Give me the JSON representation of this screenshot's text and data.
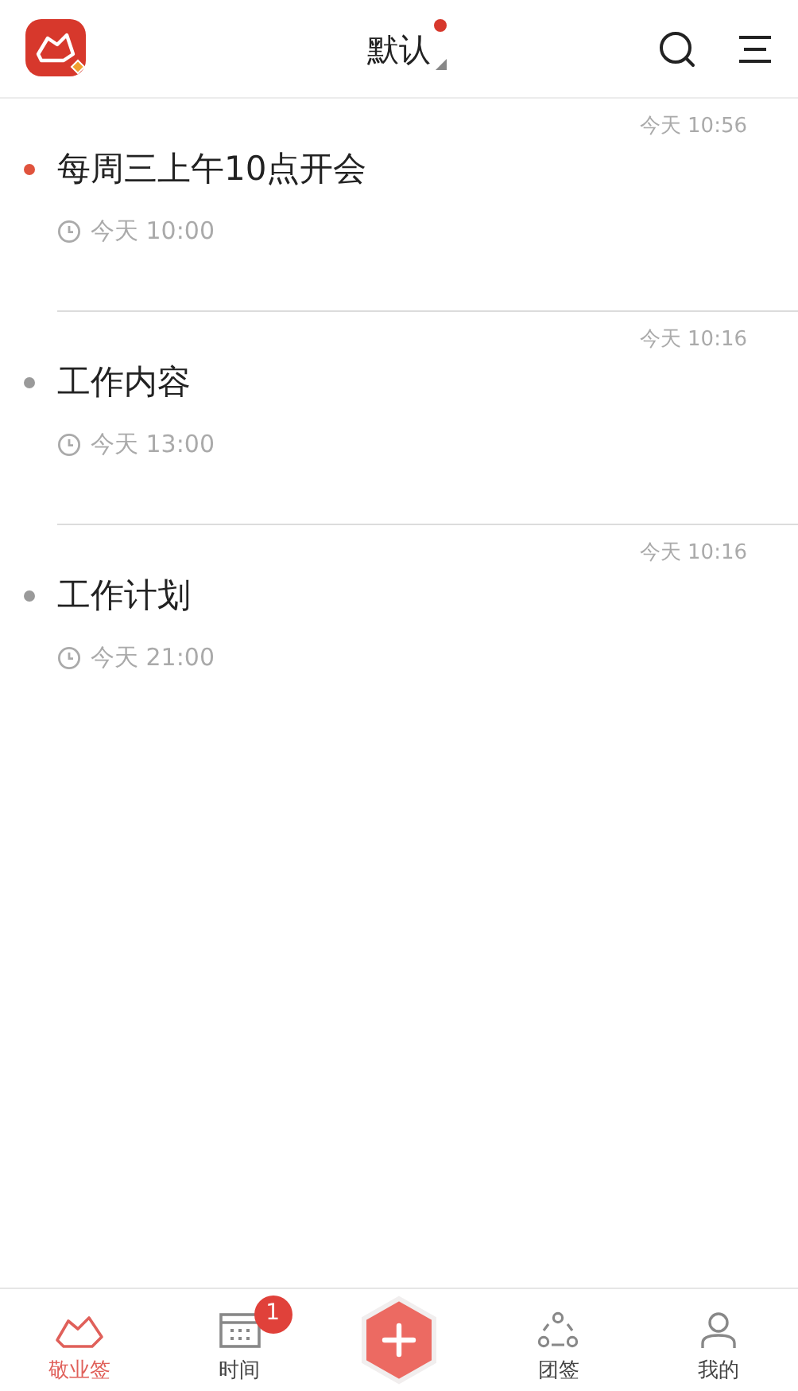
{
  "header": {
    "title": "默认",
    "unread": true
  },
  "notes": [
    {
      "created": "今天 10:56",
      "title": "每周三上午10点开会",
      "reminder": "今天 10:00",
      "color": "#e0533d"
    },
    {
      "created": "今天 10:16",
      "title": "工作内容",
      "reminder": "今天 13:00",
      "color": "#9a9a9a"
    },
    {
      "created": "今天 10:16",
      "title": "工作计划",
      "reminder": "今天 21:00",
      "color": "#9a9a9a"
    }
  ],
  "tabs": [
    {
      "kind": "notes",
      "label": "敬业签",
      "selected": true
    },
    {
      "kind": "calendar",
      "label": "时间",
      "selected": false,
      "badge": "1"
    },
    {
      "kind": "add"
    },
    {
      "kind": "team",
      "label": "团签",
      "selected": false
    },
    {
      "kind": "profile",
      "label": "我的",
      "selected": false
    }
  ]
}
